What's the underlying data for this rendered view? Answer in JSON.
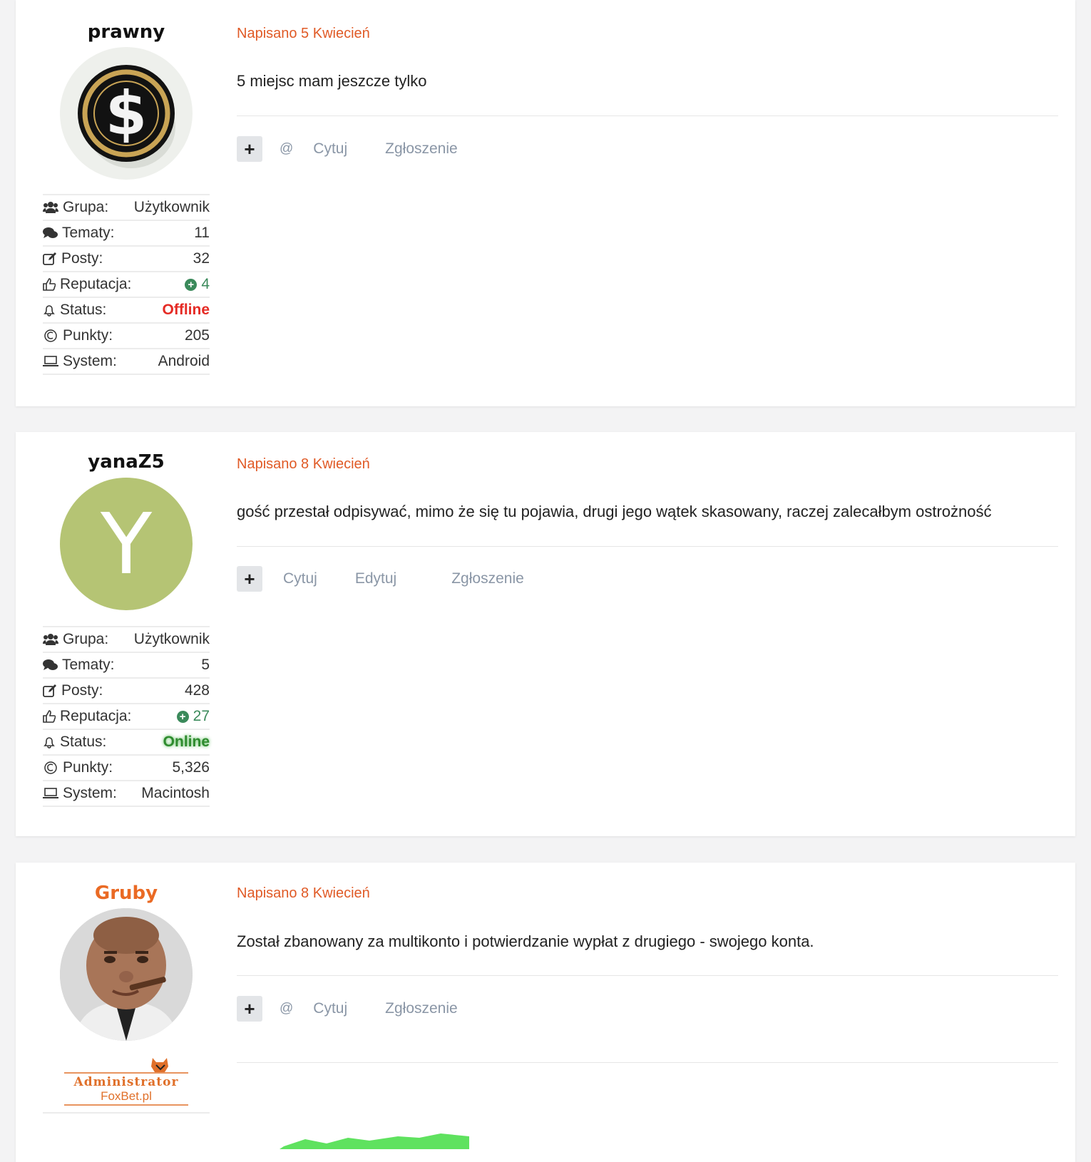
{
  "posts": [
    {
      "username": "prawny",
      "avatar": "dollar-coin-icon",
      "date": "Napisano 5 Kwiecień",
      "body": "5 miejsc mam jeszcze tylko",
      "actions": {
        "mention": "@",
        "quote": "Cytuj",
        "report": "Zgłoszenie"
      },
      "stats": {
        "group_label": "Grupa:",
        "group_value": "Użytkownik",
        "topics_label": "Tematy:",
        "topics_value": "11",
        "posts_label": "Posty:",
        "posts_value": "32",
        "rep_label": "Reputacja:",
        "rep_value": "4",
        "status_label": "Status:",
        "status_value": "Offline",
        "points_label": "Punkty:",
        "points_value": "205",
        "system_label": "System:",
        "system_value": "Android"
      }
    },
    {
      "username": "yanaZ5",
      "avatar_letter": "Y",
      "date": "Napisano 8 Kwiecień",
      "body": "gość przestał odpisywać, mimo że się tu pojawia, drugi jego wątek skasowany, raczej zalecałbym ostrożność",
      "actions": {
        "quote": "Cytuj",
        "edit": "Edytuj",
        "report": "Zgłoszenie"
      },
      "stats": {
        "group_label": "Grupa:",
        "group_value": "Użytkownik",
        "topics_label": "Tematy:",
        "topics_value": "5",
        "posts_label": "Posty:",
        "posts_value": "428",
        "rep_label": "Reputacja:",
        "rep_value": "27",
        "status_label": "Status:",
        "status_value": "Online",
        "points_label": "Punkty:",
        "points_value": "5,326",
        "system_label": "System:",
        "system_value": "Macintosh"
      }
    },
    {
      "username": "Gruby",
      "avatar": "man-with-cigar-photo",
      "date": "Napisano 8 Kwiecień",
      "body": "Został zbanowany za multikonto i potwierdzanie wypłat z drugiego - swojego konta.",
      "actions": {
        "mention": "@",
        "quote": "Cytuj",
        "report": "Zgłoszenie"
      },
      "badge": {
        "title": "Administrator",
        "site": "FoxBet.pl"
      }
    }
  ],
  "colors": {
    "accent": "#e05a26",
    "offline": "#e52b25",
    "online": "#2e8b2e",
    "reputation": "#3b8a5b",
    "avatar_letter_bg": "#b5c474"
  }
}
